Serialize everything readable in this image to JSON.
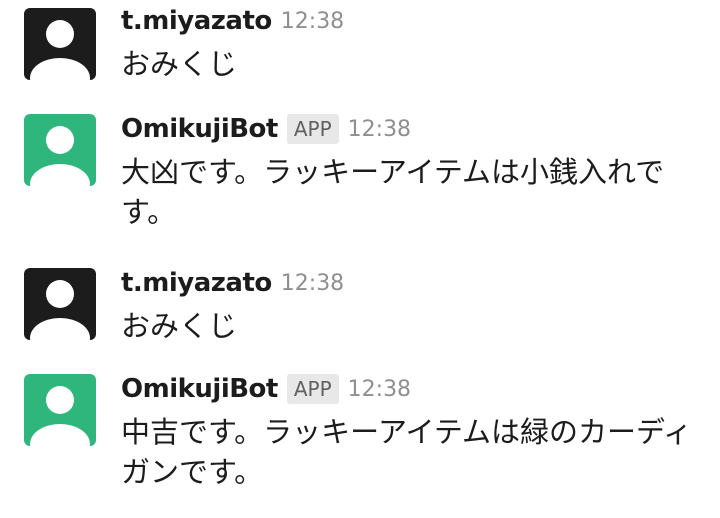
{
  "colors": {
    "user_avatar_bg": "#1d1c1d",
    "bot_avatar_bg": "#2eb67d",
    "avatar_figure": "#ffffff",
    "timestamp": "#8f8f8f",
    "badge_bg": "#e8e8e8"
  },
  "messages": [
    {
      "author": "t.miyazato",
      "is_app": false,
      "badge": "",
      "time": "12:38",
      "text": "おみくじ",
      "avatar_icon": "user-avatar-icon"
    },
    {
      "author": "OmikujiBot",
      "is_app": true,
      "badge": "APP",
      "time": "12:38",
      "text": "大凶です。ラッキーアイテムは小銭入れです。",
      "avatar_icon": "bot-avatar-icon"
    },
    {
      "author": "t.miyazato",
      "is_app": false,
      "badge": "",
      "time": "12:38",
      "text": "おみくじ",
      "avatar_icon": "user-avatar-icon"
    },
    {
      "author": "OmikujiBot",
      "is_app": true,
      "badge": "APP",
      "time": "12:38",
      "text": "中吉です。ラッキーアイテムは緑のカーディガンです。",
      "avatar_icon": "bot-avatar-icon"
    }
  ]
}
